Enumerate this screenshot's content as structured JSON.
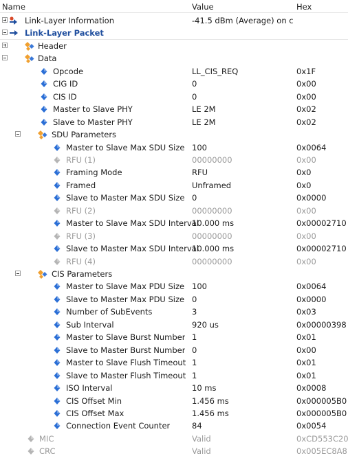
{
  "columns": {
    "name": "Name",
    "value": "Value",
    "hex": "Hex"
  },
  "rows": [
    {
      "name": "Link-Layer Information",
      "value": "-41.5 dBm (Average) on c...",
      "hex": "",
      "indent": 0,
      "expander": "plus",
      "icon": "info-arrow-icon"
    },
    {
      "name": "Link-Layer Packet",
      "value": "",
      "hex": "",
      "indent": 0,
      "expander": "minus",
      "icon": "blue-arrow-icon",
      "bold": true,
      "section": true
    },
    {
      "name": "Header",
      "value": "",
      "hex": "",
      "indent": 1,
      "expander": "plus",
      "icon": "group-icon"
    },
    {
      "name": "Data",
      "value": "",
      "hex": "",
      "indent": 1,
      "expander": "minus",
      "icon": "group-icon"
    },
    {
      "name": "Opcode",
      "value": "LL_CIS_REQ",
      "hex": "0x1F",
      "indent": 2,
      "icon": "field-icon"
    },
    {
      "name": "CIG ID",
      "value": "0",
      "hex": "0x00",
      "indent": 2,
      "icon": "field-icon"
    },
    {
      "name": "CIS ID",
      "value": "0",
      "hex": "0x00",
      "indent": 2,
      "icon": "field-icon"
    },
    {
      "name": "Master to Slave PHY",
      "value": "LE 2M",
      "hex": "0x02",
      "indent": 2,
      "icon": "field-icon"
    },
    {
      "name": "Slave to Master PHY",
      "value": "LE 2M",
      "hex": "0x02",
      "indent": 2,
      "icon": "field-icon"
    },
    {
      "name": "SDU Parameters",
      "value": "",
      "hex": "",
      "indent": 2,
      "expander": "minus",
      "icon": "group-icon"
    },
    {
      "name": "Master to Slave Max SDU Size",
      "value": "100",
      "hex": "0x0064",
      "indent": 3,
      "icon": "field-icon"
    },
    {
      "name": "RFU (1)",
      "value": "00000000",
      "hex": "0x00",
      "indent": 3,
      "icon": "rfu-icon",
      "gray": true
    },
    {
      "name": "Framing Mode",
      "value": "RFU",
      "hex": "0x0",
      "indent": 3,
      "icon": "field-icon"
    },
    {
      "name": "Framed",
      "value": "Unframed",
      "hex": "0x0",
      "indent": 3,
      "icon": "field-icon"
    },
    {
      "name": "Slave to Master Max SDU Size",
      "value": "0",
      "hex": "0x0000",
      "indent": 3,
      "icon": "field-icon"
    },
    {
      "name": "RFU (2)",
      "value": "00000000",
      "hex": "0x00",
      "indent": 3,
      "icon": "rfu-icon",
      "gray": true
    },
    {
      "name": "Master to Slave Max SDU Interval",
      "value": "10.000 ms",
      "hex": "0x00002710",
      "indent": 3,
      "icon": "field-icon"
    },
    {
      "name": "RFU (3)",
      "value": "00000000",
      "hex": "0x00",
      "indent": 3,
      "icon": "rfu-icon",
      "gray": true
    },
    {
      "name": "Slave to Master Max SDU Interval",
      "value": "10.000 ms",
      "hex": "0x00002710",
      "indent": 3,
      "icon": "field-icon"
    },
    {
      "name": "RFU (4)",
      "value": "00000000",
      "hex": "0x00",
      "indent": 3,
      "icon": "rfu-icon",
      "gray": true
    },
    {
      "name": "CIS Parameters",
      "value": "",
      "hex": "",
      "indent": 2,
      "expander": "minus",
      "icon": "group-icon"
    },
    {
      "name": "Master to Slave Max PDU Size",
      "value": "100",
      "hex": "0x0064",
      "indent": 3,
      "icon": "field-icon"
    },
    {
      "name": "Slave to Master Max PDU Size",
      "value": "0",
      "hex": "0x0000",
      "indent": 3,
      "icon": "field-icon"
    },
    {
      "name": "Number of SubEvents",
      "value": "3",
      "hex": "0x03",
      "indent": 3,
      "icon": "field-icon"
    },
    {
      "name": "Sub Interval",
      "value": "920 us",
      "hex": "0x00000398",
      "indent": 3,
      "icon": "field-icon"
    },
    {
      "name": "Master to Slave Burst Number",
      "value": "1",
      "hex": "0x01",
      "indent": 3,
      "icon": "field-icon"
    },
    {
      "name": "Slave to Master Burst Number",
      "value": "0",
      "hex": "0x00",
      "indent": 3,
      "icon": "field-icon"
    },
    {
      "name": "Master to Slave Flush Timeout",
      "value": "1",
      "hex": "0x01",
      "indent": 3,
      "icon": "field-icon"
    },
    {
      "name": "Slave to Master Flush Timeout",
      "value": "1",
      "hex": "0x01",
      "indent": 3,
      "icon": "field-icon"
    },
    {
      "name": "ISO Interval",
      "value": "10 ms",
      "hex": "0x0008",
      "indent": 3,
      "icon": "field-icon"
    },
    {
      "name": "CIS Offset Min",
      "value": "1.456 ms",
      "hex": "0x000005B0",
      "indent": 3,
      "icon": "field-icon"
    },
    {
      "name": "CIS Offset Max",
      "value": "1.456 ms",
      "hex": "0x000005B0",
      "indent": 3,
      "icon": "field-icon"
    },
    {
      "name": "Connection Event Counter",
      "value": "84",
      "hex": "0x0054",
      "indent": 3,
      "icon": "field-icon"
    },
    {
      "name": "MIC",
      "value": "Valid",
      "hex": "0xCD553C20",
      "indent": 1,
      "icon": "rfu-icon",
      "gray": true
    },
    {
      "name": "CRC",
      "value": "Valid",
      "hex": "0x005EC8A8",
      "indent": 1,
      "icon": "rfu-icon",
      "gray": true
    }
  ],
  "colors": {
    "field_icon": "#2b6fd6",
    "group_icon_orange": "#f0a030",
    "group_icon_blue": "#3a78d8",
    "rfu_icon": "#b5b5b5",
    "section_text": "#1f4e9e",
    "gray_text": "#9a9a9a"
  }
}
